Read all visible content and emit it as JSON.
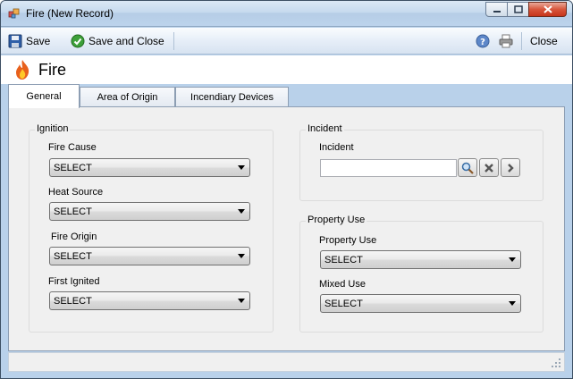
{
  "window": {
    "title": "Fire (New Record)"
  },
  "toolbar": {
    "save_label": "Save",
    "save_close_label": "Save and Close",
    "close_label": "Close"
  },
  "header": {
    "title": "Fire",
    "icon": "flame-icon"
  },
  "tabs": [
    {
      "label": "General",
      "active": true
    },
    {
      "label": "Area of Origin",
      "active": false
    },
    {
      "label": "Incendiary Devices",
      "active": false
    }
  ],
  "ignition": {
    "title": "Ignition",
    "fields": [
      {
        "label": "Fire Cause",
        "value": "SELECT"
      },
      {
        "label": "Heat Source",
        "value": "SELECT"
      },
      {
        "label": "Fire Origin",
        "value": "SELECT"
      },
      {
        "label": "First Ignited",
        "value": "SELECT"
      }
    ]
  },
  "incident": {
    "title": "Incident",
    "label": "Incident",
    "value": ""
  },
  "property_use": {
    "title": "Property Use",
    "fields": [
      {
        "label": "Property Use",
        "value": "SELECT"
      },
      {
        "label": "Mixed Use",
        "value": "SELECT"
      }
    ]
  },
  "colors": {
    "titlebar": "#c6daee",
    "close_button": "#d7553b",
    "panel": "#f0f0f0"
  }
}
